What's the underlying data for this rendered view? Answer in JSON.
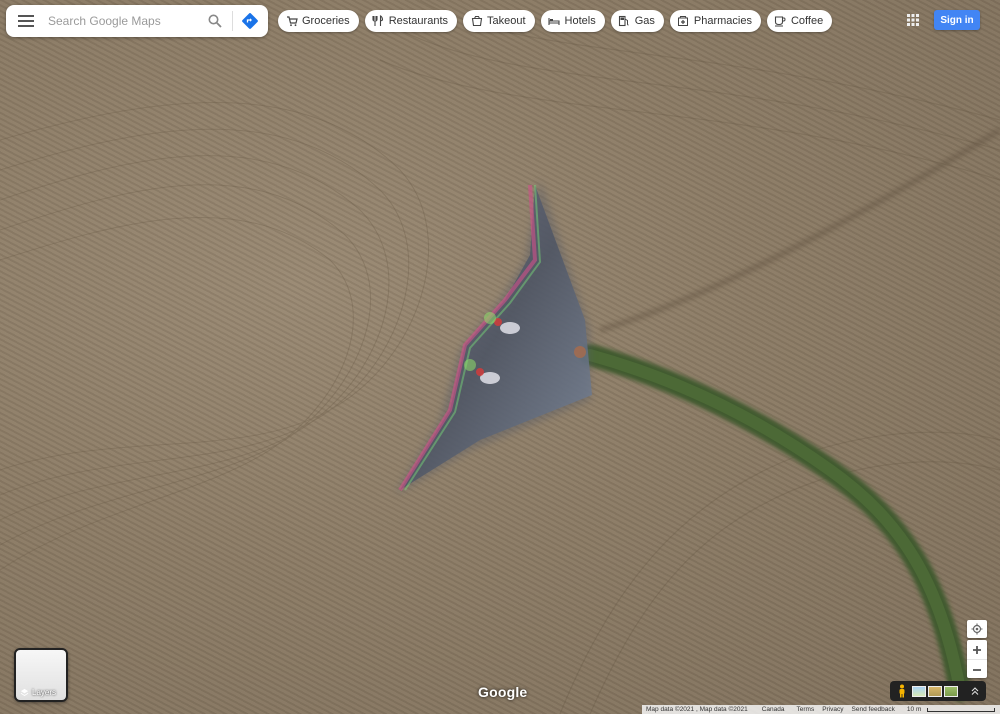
{
  "search": {
    "placeholder": "Search Google Maps"
  },
  "chips": [
    {
      "label": "Groceries",
      "icon": "cart-icon"
    },
    {
      "label": "Restaurants",
      "icon": "fork-knife-icon"
    },
    {
      "label": "Takeout",
      "icon": "takeout-icon"
    },
    {
      "label": "Hotels",
      "icon": "bed-icon"
    },
    {
      "label": "Gas",
      "icon": "gas-pump-icon"
    },
    {
      "label": "Pharmacies",
      "icon": "pharmacy-icon"
    },
    {
      "label": "Coffee",
      "icon": "coffee-icon"
    }
  ],
  "header": {
    "signin_label": "Sign in"
  },
  "layers": {
    "label": "Layers"
  },
  "map": {
    "logo": "Google",
    "view": "satellite"
  },
  "footer": {
    "attribution": "Map data ©2021 , Map data ©2021",
    "region": "Canada",
    "terms": "Terms",
    "privacy": "Privacy",
    "feedback": "Send feedback",
    "scale": "10 m"
  },
  "colors": {
    "accent": "#4285f4",
    "directions": "#1a73e8"
  }
}
